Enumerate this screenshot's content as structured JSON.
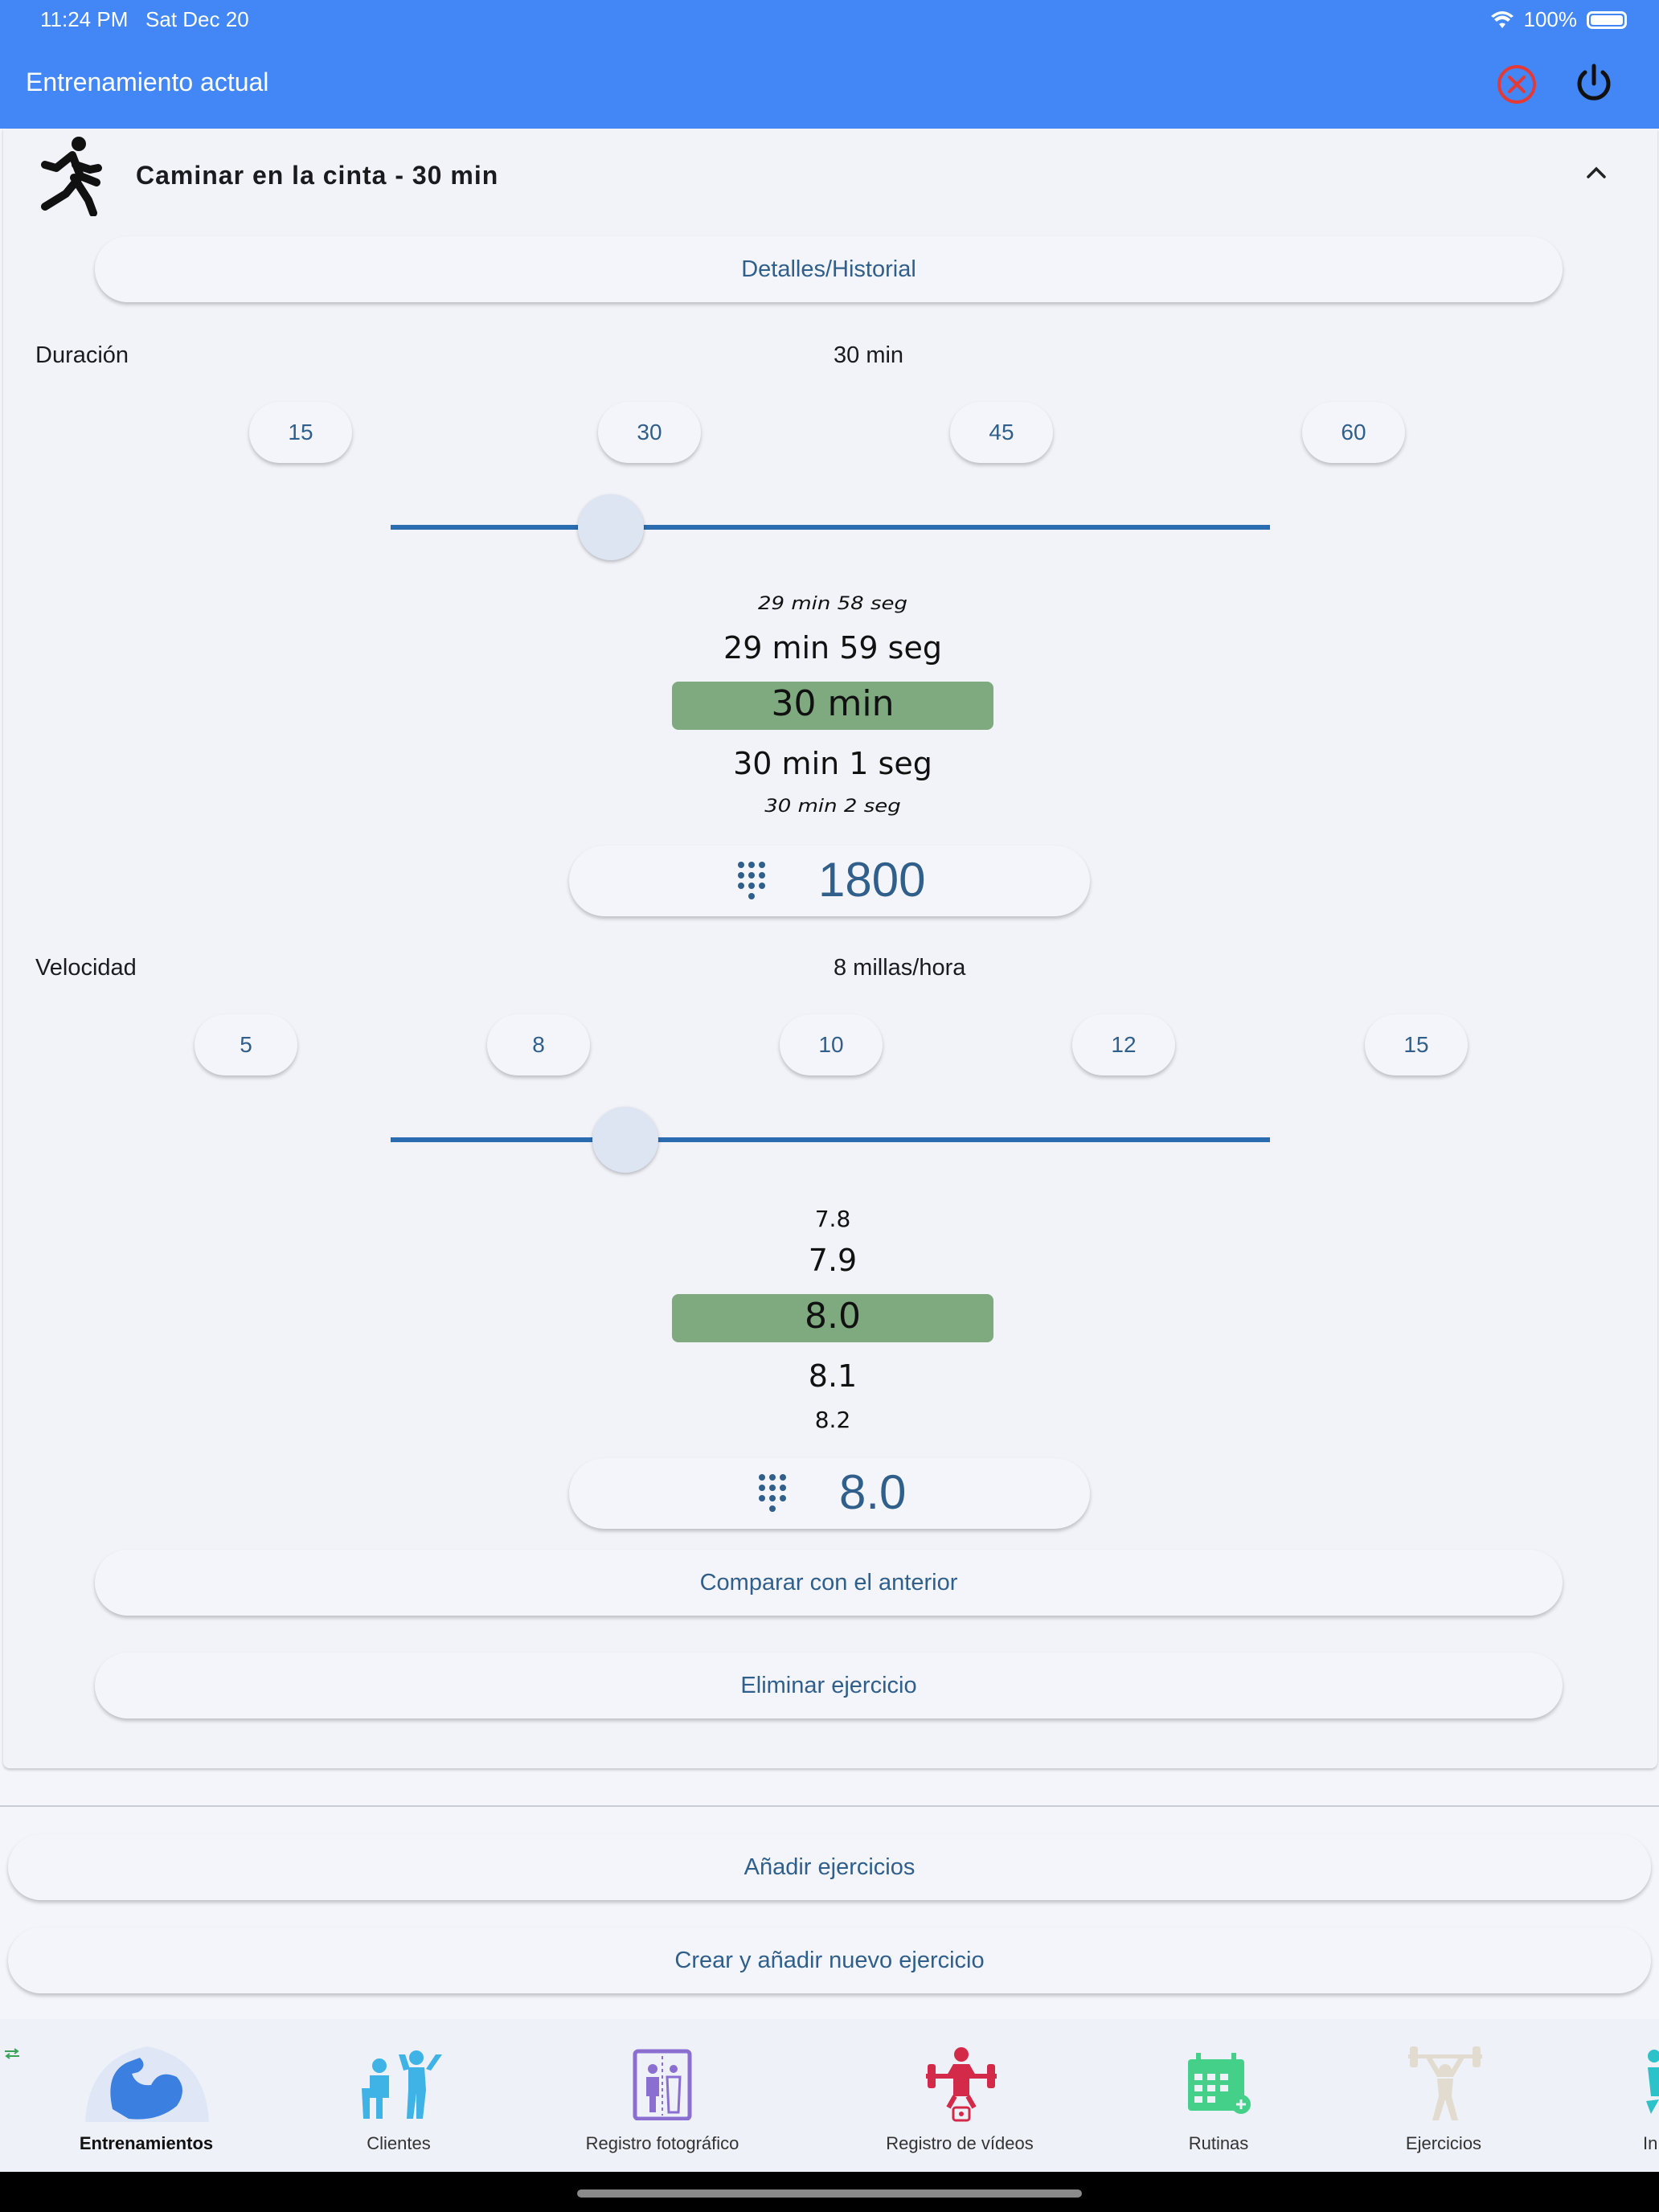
{
  "status_bar": {
    "time": "11:24 PM",
    "date": "Sat Dec 20",
    "battery": "100%",
    "icons": [
      "wifi-icon",
      "battery-icon"
    ]
  },
  "app_bar": {
    "title": "Entrenamiento actual",
    "icons": [
      "cancel-circle-icon",
      "power-icon"
    ],
    "cancel_color": "#e53935",
    "background": "#4287f5"
  },
  "exercise": {
    "name": "Caminar en la cinta - 30 min",
    "icon": "running-person-icon",
    "details_button": "Detalles/Historial",
    "duration": {
      "label": "Duración",
      "value_text": "30 min",
      "presets": [
        "15",
        "30",
        "45",
        "60"
      ],
      "slider_fraction": 0.25,
      "wheel": [
        "29 min 58 seg",
        "29 min 59 seg",
        "30 min",
        "30 min 1 seg",
        "30 min 2 seg"
      ],
      "input_value": "1800"
    },
    "speed": {
      "label": "Velocidad",
      "value_text": "8 millas/hora",
      "presets": [
        "5",
        "8",
        "10",
        "12",
        "15"
      ],
      "slider_fraction": 0.267,
      "wheel": [
        "7.8",
        "7.9",
        "8.0",
        "8.1",
        "8.2"
      ],
      "input_value": "8.0"
    },
    "compare_button": "Comparar con el anterior",
    "delete_button": "Eliminar ejercicio"
  },
  "actions": {
    "add_exercises": "Añadir ejercicios",
    "create_and_add": "Crear y añadir nuevo ejercicio"
  },
  "bottom_nav": [
    {
      "label": "Entrenamientos",
      "icon": "flexed-arm-icon",
      "active": true
    },
    {
      "label": "Clientes",
      "icon": "trainer-client-icon",
      "active": false
    },
    {
      "label": "Registro fotográfico",
      "icon": "photo-log-icon",
      "active": false
    },
    {
      "label": "Registro de vídeos",
      "icon": "weightlifter-video-icon",
      "active": false
    },
    {
      "label": "Rutinas",
      "icon": "calendar-icon",
      "active": false
    },
    {
      "label": "Ejercicios",
      "icon": "barbell-person-icon",
      "active": false
    },
    {
      "label": "In",
      "icon": "partial-icon",
      "active": false
    }
  ],
  "colors": {
    "selection": "#7faa7f",
    "accent_text": "#2f5f8a",
    "slider": "#2b6cb0"
  }
}
